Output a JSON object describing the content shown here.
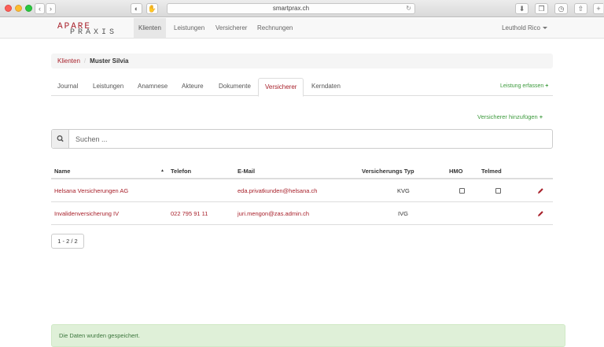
{
  "browser": {
    "url": "smartprax.ch"
  },
  "brand": {
    "logo_top": "APARE",
    "logo_bottom": "PRAXIS",
    "accent_color": "#a8212b",
    "success_color": "#3c9a3c"
  },
  "nav": {
    "items": [
      {
        "label": "Klienten",
        "active": true
      },
      {
        "label": "Leistungen",
        "active": false
      },
      {
        "label": "Versicherer",
        "active": false
      },
      {
        "label": "Rechnungen",
        "active": false
      }
    ],
    "user": "Leuthold Rico"
  },
  "breadcrumb": {
    "parent": "Klienten",
    "separator": "/",
    "current": "Muster Silvia"
  },
  "tabs": {
    "items": [
      {
        "label": "Journal",
        "active": false
      },
      {
        "label": "Leistungen",
        "active": false
      },
      {
        "label": "Anamnese",
        "active": false
      },
      {
        "label": "Akteure",
        "active": false
      },
      {
        "label": "Dokumente",
        "active": false
      },
      {
        "label": "Versicherer",
        "active": true
      },
      {
        "label": "Kerndaten",
        "active": false
      }
    ],
    "action_label": "Leistung erfassen"
  },
  "insurer": {
    "add_label": "Versicherer hinzufügen",
    "search_placeholder": "Suchen ..."
  },
  "table": {
    "headers": {
      "name": "Name",
      "phone": "Telefon",
      "email": "E-Mail",
      "type": "Versicherungs Typ",
      "hmo": "HMO",
      "telmed": "Telmed"
    },
    "sort_indicator": "▲",
    "rows": [
      {
        "name": "Helsana Versicherungen AG",
        "phone": "",
        "email": "eda.privatkunden@helsana.ch",
        "type": "KVG",
        "hmo": false,
        "telmed": false,
        "has_checkboxes": true
      },
      {
        "name": "Invalidenversicherung IV",
        "phone": "022 795 91 11",
        "email": "juri.mengon@zas.admin.ch",
        "type": "IVG",
        "hmo": false,
        "telmed": false,
        "has_checkboxes": false
      }
    ]
  },
  "pagination": {
    "label": "1 - 2 / 2"
  },
  "alert": {
    "message": "Die Daten wurden gespeichert."
  }
}
